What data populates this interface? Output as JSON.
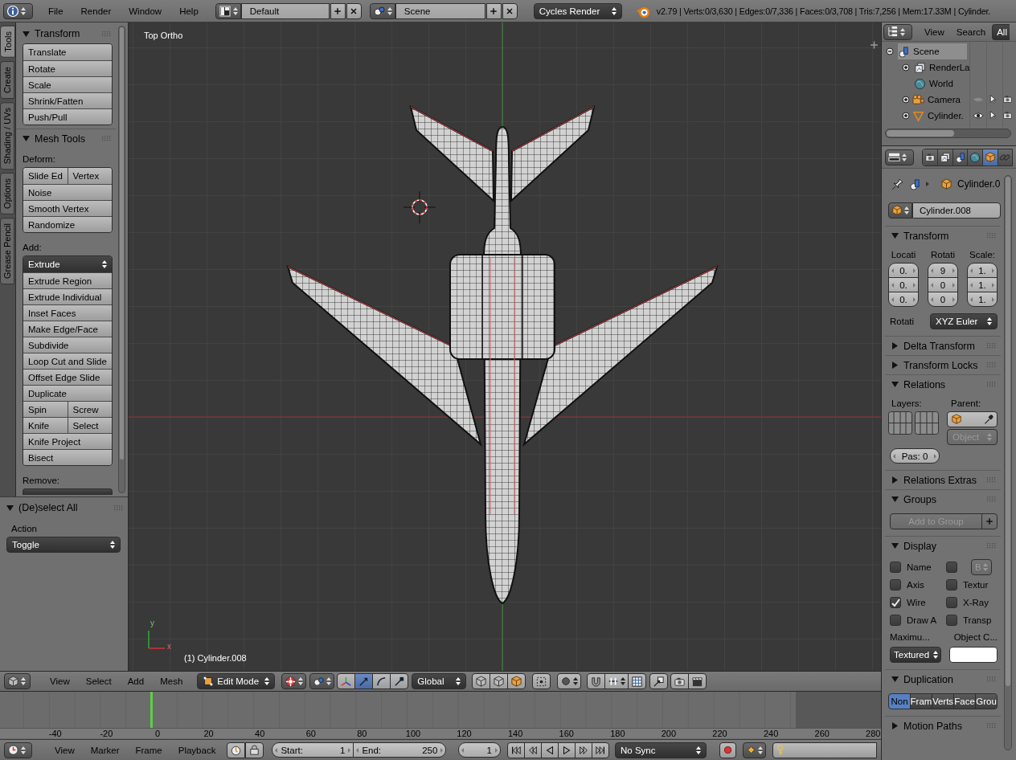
{
  "top_bar": {
    "menus": [
      "File",
      "Render",
      "Window",
      "Help"
    ],
    "screen_layout": "Default",
    "scene": "Scene",
    "render_engine": "Cycles Render",
    "stats": "v2.79 | Verts:0/3,630 | Edges:0/7,336 | Faces:0/3,708 | Tris:7,256 | Mem:17.33M | Cylinder."
  },
  "tool_shelf": {
    "tabs": [
      {
        "label": "Tools",
        "selected": true
      },
      {
        "label": "Create",
        "selected": false
      },
      {
        "label": "Shading / UVs",
        "selected": false
      },
      {
        "label": "Options",
        "selected": false
      },
      {
        "label": "Grease Pencil",
        "selected": false
      }
    ],
    "panels": [
      {
        "title": "Transform",
        "expanded": true,
        "items": [
          {
            "kind": "column",
            "rows": [
              [
                "Translate"
              ],
              [
                "Rotate"
              ],
              [
                "Scale"
              ],
              [
                "Shrink/Fatten"
              ],
              [
                "Push/Pull"
              ]
            ]
          }
        ]
      },
      {
        "title": "Mesh Tools",
        "expanded": true,
        "items": [
          {
            "kind": "label",
            "text": "Deform:"
          },
          {
            "kind": "column",
            "rows": [
              [
                "Slide Ed",
                "Vertex"
              ],
              [
                "Noise"
              ],
              [
                "Smooth Vertex"
              ],
              [
                "Randomize"
              ]
            ]
          },
          {
            "kind": "label",
            "text": "Add:"
          },
          {
            "kind": "column",
            "dropdown": "Extrude",
            "rows": [
              [
                "Extrude Region"
              ],
              [
                "Extrude Individual"
              ],
              [
                "Inset Faces"
              ],
              [
                "Make Edge/Face"
              ],
              [
                "Subdivide"
              ],
              [
                "Loop Cut and Slide"
              ],
              [
                "Offset Edge Slide"
              ],
              [
                "Duplicate"
              ],
              [
                "Spin",
                "Screw"
              ],
              [
                "Knife",
                "Select"
              ],
              [
                "Knife Project"
              ],
              [
                "Bisect"
              ]
            ]
          },
          {
            "kind": "label",
            "text": "Remove:"
          },
          {
            "kind": "cut_dropdown"
          }
        ]
      }
    ]
  },
  "operator_panel": {
    "title": "(De)select All",
    "expanded": true,
    "label": "Action",
    "value": "Toggle"
  },
  "viewport": {
    "view_name": "Top Ortho",
    "object_label": "(1) Cylinder.008",
    "gizmo_labels": [
      "y",
      "x"
    ]
  },
  "outliner": {
    "menus": [
      "View",
      "Search"
    ],
    "filter": "All",
    "tree": [
      {
        "name": "Scene",
        "kind": "scene",
        "selected": true,
        "expanded": true,
        "children": [
          {
            "name": "RenderLa",
            "kind": "render_layers",
            "selected": false,
            "expanded": false
          },
          {
            "name": "World",
            "kind": "world",
            "selected": false
          },
          {
            "name": "Camera",
            "kind": "camera",
            "selected": false,
            "expanded": false,
            "visible": false
          },
          {
            "name": "Cylinder.",
            "kind": "mesh",
            "selected": false,
            "expanded": false,
            "visible": true
          }
        ]
      }
    ]
  },
  "properties": {
    "context_tabs": [
      {
        "kind": "render",
        "selected": false
      },
      {
        "kind": "render_layers",
        "selected": false
      },
      {
        "kind": "scene",
        "selected": false
      },
      {
        "kind": "world",
        "selected": false
      },
      {
        "kind": "object",
        "selected": true
      },
      {
        "kind": "constraints",
        "selected": false
      }
    ],
    "breadcrumb": "Cylinder.0",
    "object_name": "Cylinder.008",
    "panels": [
      {
        "title": "Transform",
        "expanded": true,
        "kind": "transform",
        "columns": [
          {
            "label": "Locati",
            "values": [
              "0.",
              "0.",
              "0."
            ]
          },
          {
            "label": "Rotati",
            "values": [
              "9",
              "0",
              "0"
            ]
          },
          {
            "label": "Scale:",
            "values": [
              "1.",
              "1.",
              "1."
            ]
          }
        ],
        "mode_label": "Rotati",
        "mode": "XYZ Euler"
      },
      {
        "title": "Delta Transform",
        "expanded": false
      },
      {
        "title": "Transform Locks",
        "expanded": false
      },
      {
        "title": "Relations",
        "expanded": true,
        "kind": "relations",
        "layers_label": "Layers:",
        "parent_label": "Parent:",
        "parent_type": "Object",
        "pass_index": "Pas: 0"
      },
      {
        "title": "Relations Extras",
        "expanded": false
      },
      {
        "title": "Groups",
        "expanded": true,
        "kind": "groups",
        "button": "Add to Group"
      },
      {
        "title": "Display",
        "expanded": true,
        "kind": "display",
        "checkboxes": [
          {
            "label": "Name",
            "checked": false
          },
          {
            "dropdown": "B",
            "checked": false
          },
          {
            "label": "Axis",
            "checked": false
          },
          {
            "label": "Textur",
            "checked": false
          },
          {
            "label": "Wire",
            "checked": true
          },
          {
            "label": "X-Ray",
            "checked": false
          },
          {
            "label": "Draw A",
            "checked": false
          },
          {
            "label": "Transp",
            "checked": false
          }
        ],
        "max_label": "Maximu...",
        "max_value": "Textured",
        "color_label": "Object C...",
        "color": "#ffffff"
      },
      {
        "title": "Duplication",
        "expanded": true,
        "kind": "duplication",
        "options": [
          {
            "label": "Non",
            "selected": true
          },
          {
            "label": "Fram",
            "selected": false
          },
          {
            "label": "Verts",
            "selected": false
          },
          {
            "label": "Face",
            "selected": false
          },
          {
            "label": "Grou",
            "selected": false
          }
        ]
      },
      {
        "title": "Motion Paths",
        "expanded": false
      }
    ]
  },
  "view3d_header": {
    "menus": [
      "View",
      "Select",
      "Add",
      "Mesh"
    ],
    "mode": "Edit Mode",
    "orientation": "Global",
    "manipulators": [
      {
        "kind": "axes",
        "selected": false
      },
      {
        "kind": "translate",
        "selected": true
      },
      {
        "kind": "rotate",
        "selected": false
      },
      {
        "kind": "scale",
        "selected": false
      }
    ]
  },
  "timeline": {
    "ruler": [
      "-40",
      "-20",
      "0",
      "20",
      "40",
      "60",
      "80",
      "100",
      "120",
      "140",
      "160",
      "180",
      "200",
      "220",
      "240",
      "260",
      "280"
    ],
    "playhead": {
      "level": 0.172
    }
  },
  "timeline_header": {
    "menus": [
      "View",
      "Marker",
      "Frame",
      "Playback"
    ],
    "start_label": "Start:",
    "start_value": "1",
    "end_label": "End:",
    "end_value": "250",
    "current_frame": "1",
    "sync": "No Sync"
  }
}
